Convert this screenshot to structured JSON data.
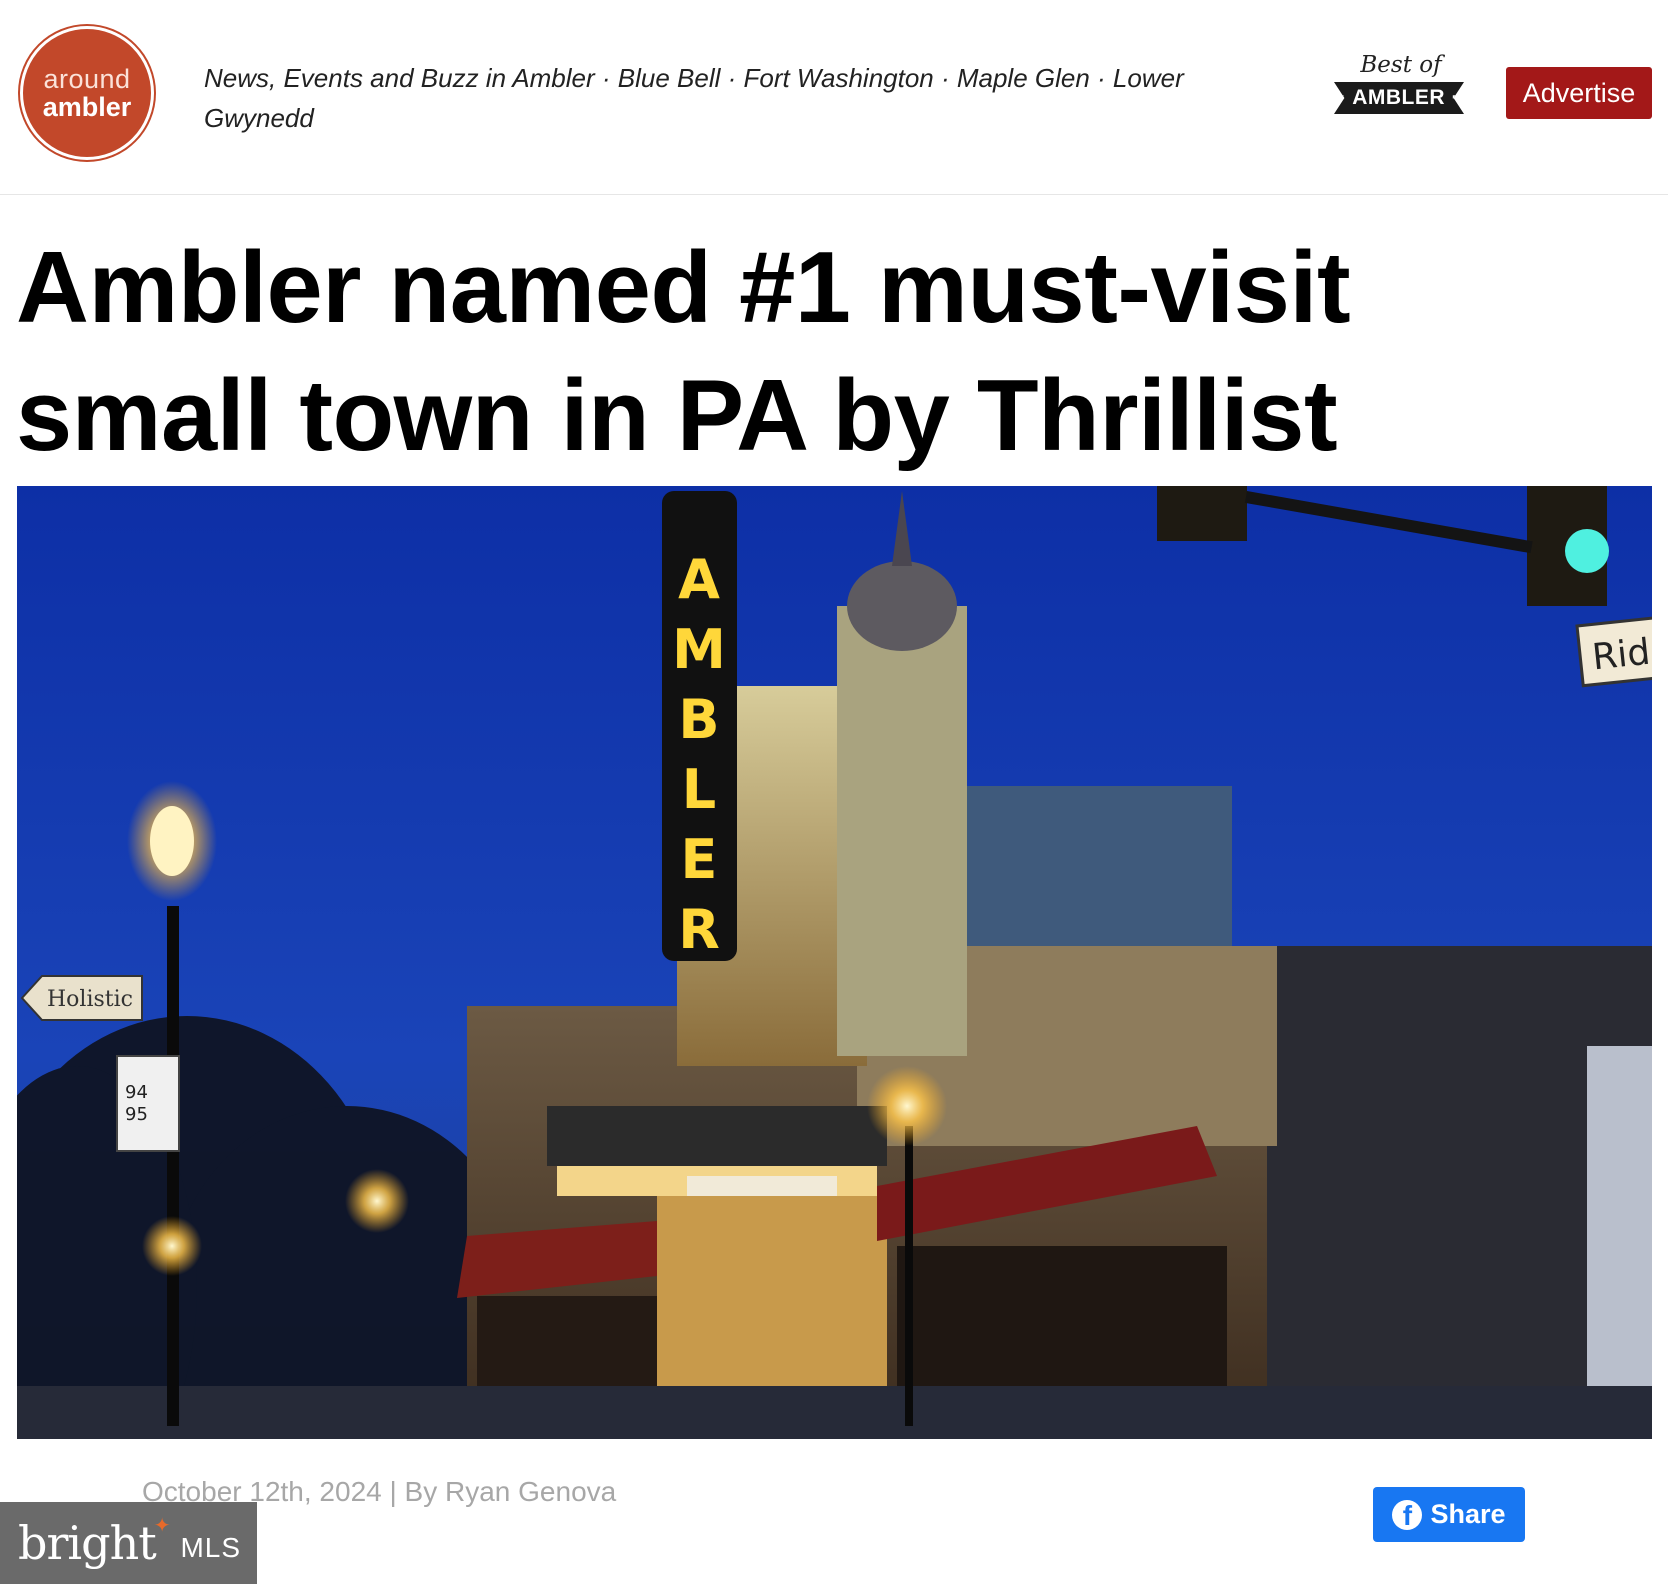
{
  "header": {
    "logo_line1": "around",
    "logo_line2": "ambler",
    "tagline": "News, Events and Buzz in Ambler · Blue Bell · Fort Washington · Maple Glen · Lower Gwynedd",
    "best_of_script": "Best of",
    "best_of_ribbon": "· AMBLER ·",
    "advertise_label": "Advertise"
  },
  "article": {
    "headline": "Ambler named #1 must-visit small town in PA by Thrillist",
    "hero_alt": "Ambler Theater marquee at dusk",
    "hero_sign": {
      "letters": [
        "A",
        "M",
        "B",
        "L",
        "E",
        "R"
      ],
      "road_sign": "Rid",
      "bus_stop": [
        "94",
        "95"
      ],
      "shop_sign": "Holistic"
    },
    "byline": "October 12th, 2024 | By Ryan Genova",
    "share_label": "Share"
  },
  "watermark": {
    "brand": "bright",
    "suffix": "MLS"
  },
  "colors": {
    "brand_orange": "#c2482a",
    "advertise_red": "#a31818",
    "facebook_blue": "#1877f2",
    "sky_blue": "#1437a8"
  }
}
